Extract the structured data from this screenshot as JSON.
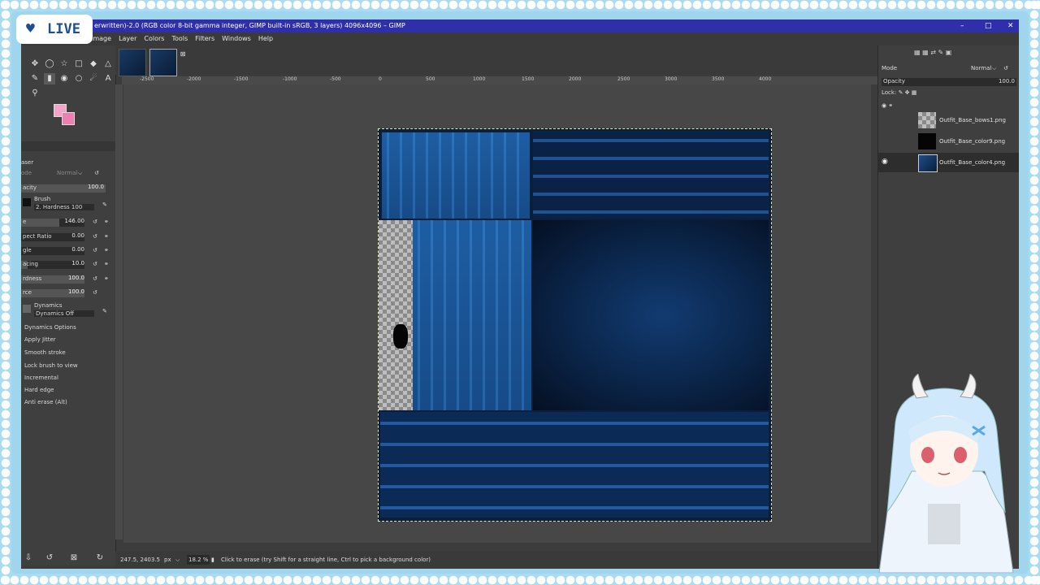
{
  "badge": {
    "live_label": "LIVE"
  },
  "window": {
    "title": "erwritten)-2.0 (RGB color 8-bit gamma integer, GIMP built-in sRGB, 3 layers) 4096x4096 – GIMP"
  },
  "menu": [
    "Image",
    "Layer",
    "Colors",
    "Tools",
    "Filters",
    "Windows",
    "Help"
  ],
  "ruler": [
    "-2500",
    "-2000",
    "-1500",
    "-1000",
    "-500",
    "0",
    "500",
    "1000",
    "1500",
    "2000",
    "2500",
    "3000",
    "3500",
    "4000"
  ],
  "tool_options": {
    "title": "aser",
    "mode_label": "ode",
    "mode_value": "Normal",
    "opacity": {
      "label": "acity",
      "value": "100.0"
    },
    "brush_label": "Brush",
    "brush_name": "2. Hardness 100",
    "size": {
      "label": "e",
      "value": "146.00"
    },
    "aspect": {
      "label": "pect Ratio",
      "value": "0.00"
    },
    "angle": {
      "label": "gle",
      "value": "0.00"
    },
    "spacing": {
      "label": "acing",
      "value": "10.0"
    },
    "hardness": {
      "label": "rdness",
      "value": "100.0"
    },
    "force": {
      "label": "rce",
      "value": "100.0"
    },
    "dynamics_label": "Dynamics",
    "dynamics_value": "Dynamics Off",
    "options": [
      "Dynamics Options",
      "Apply Jitter",
      "Smooth stroke",
      "Lock brush to view",
      "Incremental",
      "Hard edge",
      "Anti erase  (Alt)"
    ]
  },
  "layers_panel": {
    "mode_label": "Mode",
    "mode_value": "Normal",
    "opacity_label": "Opacity",
    "opacity_value": "100.0",
    "lock_label": "Lock:",
    "layers": [
      {
        "name": "Outfit_Base_bows1.png",
        "visible": false
      },
      {
        "name": "Outfit_Base_color9.png",
        "visible": false
      },
      {
        "name": "Outfit_Base_color4.png",
        "visible": true
      }
    ]
  },
  "status": {
    "coords": "247.5, 2403.5",
    "unit": "px",
    "zoom": "18.2 %",
    "message": "Click to erase (try Shift for a straight line, Ctrl to pick a background color)"
  },
  "colors": {
    "title_bar": "#2e2fa9",
    "fg_color": "#f5a3c8",
    "bg_color": "#f07fb1",
    "frame": "#a9dcf3"
  }
}
